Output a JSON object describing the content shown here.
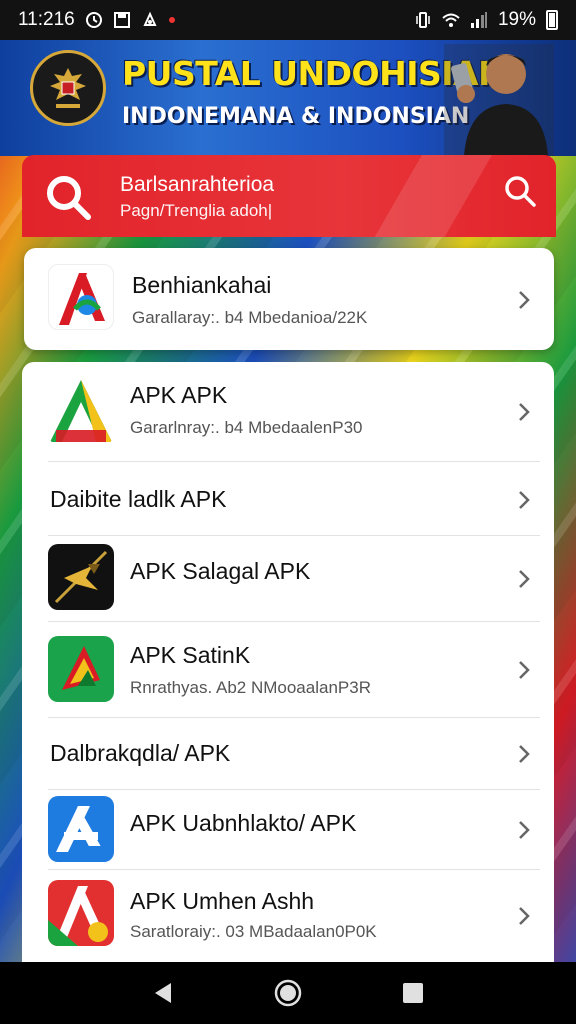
{
  "status_bar": {
    "time": "11:216",
    "battery": "19%"
  },
  "banner": {
    "title": "PUSTAL UNDOHISIAI",
    "subtitle": "INDONEMANA & INDONSIAN"
  },
  "header": {
    "title": "Barlsanrahterioa",
    "subtitle": "Pagn/Trenglia adoh|"
  },
  "featured": {
    "title": "Benhiankahai",
    "subtitle": "Garallaray:. b4 Mbedanioa/22K"
  },
  "items": [
    {
      "title": "APK APK",
      "subtitle": "Gararlnray:. b4 MbedaalenP30"
    },
    {
      "title": "Daibite ladlk APK"
    },
    {
      "title": "APK Salagal APK"
    },
    {
      "title": "APK SatinK",
      "subtitle": "Rnrathyas. Ab2 NMooaalanP3R"
    },
    {
      "title": "Dalbrakqdla/ APK"
    },
    {
      "title": "APK Uabnhlakto/ APK"
    },
    {
      "title": "APK Umhen Ashh",
      "subtitle": "Saratloraiy:. 03 MBadaalan0P0K"
    }
  ],
  "icons": {
    "status_left": [
      "clock-icon",
      "save-icon",
      "usb-debug-icon",
      "notification-dot-icon"
    ],
    "status_right": [
      "vibrate-icon",
      "wifi-icon",
      "signal-icon",
      "battery-icon"
    ],
    "header_logo": "search-logo-icon",
    "header_action": "search-icon",
    "chevron": "chevron-right-icon",
    "nav": [
      "back-icon",
      "home-icon",
      "recents-icon"
    ]
  },
  "colors": {
    "accent_red": "#e2232a",
    "banner_blue": "#1c4fbf",
    "banner_yellow": "#ffe21a"
  }
}
